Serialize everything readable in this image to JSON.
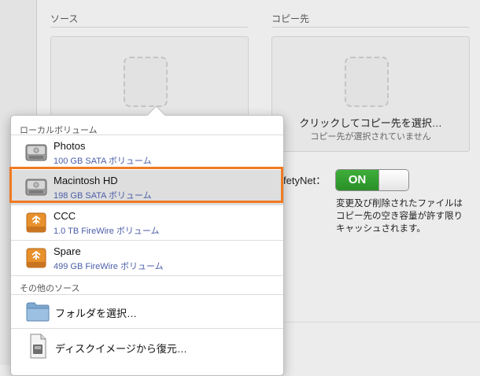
{
  "source": {
    "label": "ソース"
  },
  "destination": {
    "label": "コピー先",
    "title": "クリックしてコピー先を選択…",
    "subtitle": "コピー先が選択されていません"
  },
  "safetynet": {
    "label": "fetyNet：",
    "toggle": "ON",
    "description": [
      "変更及び削除されたファイルは",
      "コピー先の空き容量が許す限り",
      "キャッシュされます。"
    ]
  },
  "popup": {
    "local_header": "ローカルボリューム",
    "other_header": "その他のソース",
    "volumes": [
      {
        "name": "Photos",
        "detail": "100 GB SATA ボリューム",
        "icon": "internal-disk-icon"
      },
      {
        "name": "Macintosh HD",
        "detail": "198 GB SATA ボリューム",
        "icon": "internal-disk-icon"
      },
      {
        "name": "CCC",
        "detail": "1.0 TB FireWire ボリューム",
        "icon": "firewire-disk-icon"
      },
      {
        "name": "Spare",
        "detail": "499 GB FireWire ボリューム",
        "icon": "firewire-disk-icon"
      }
    ],
    "actions": [
      {
        "label": "フォルダを選択…",
        "icon": "folder-icon"
      },
      {
        "label": "ディスクイメージから復元…",
        "icon": "disk-image-icon"
      }
    ]
  },
  "colors": {
    "toggle_on": "#2f9e2c",
    "highlight": "#f07a22",
    "detail_text": "#4b5ea8"
  }
}
